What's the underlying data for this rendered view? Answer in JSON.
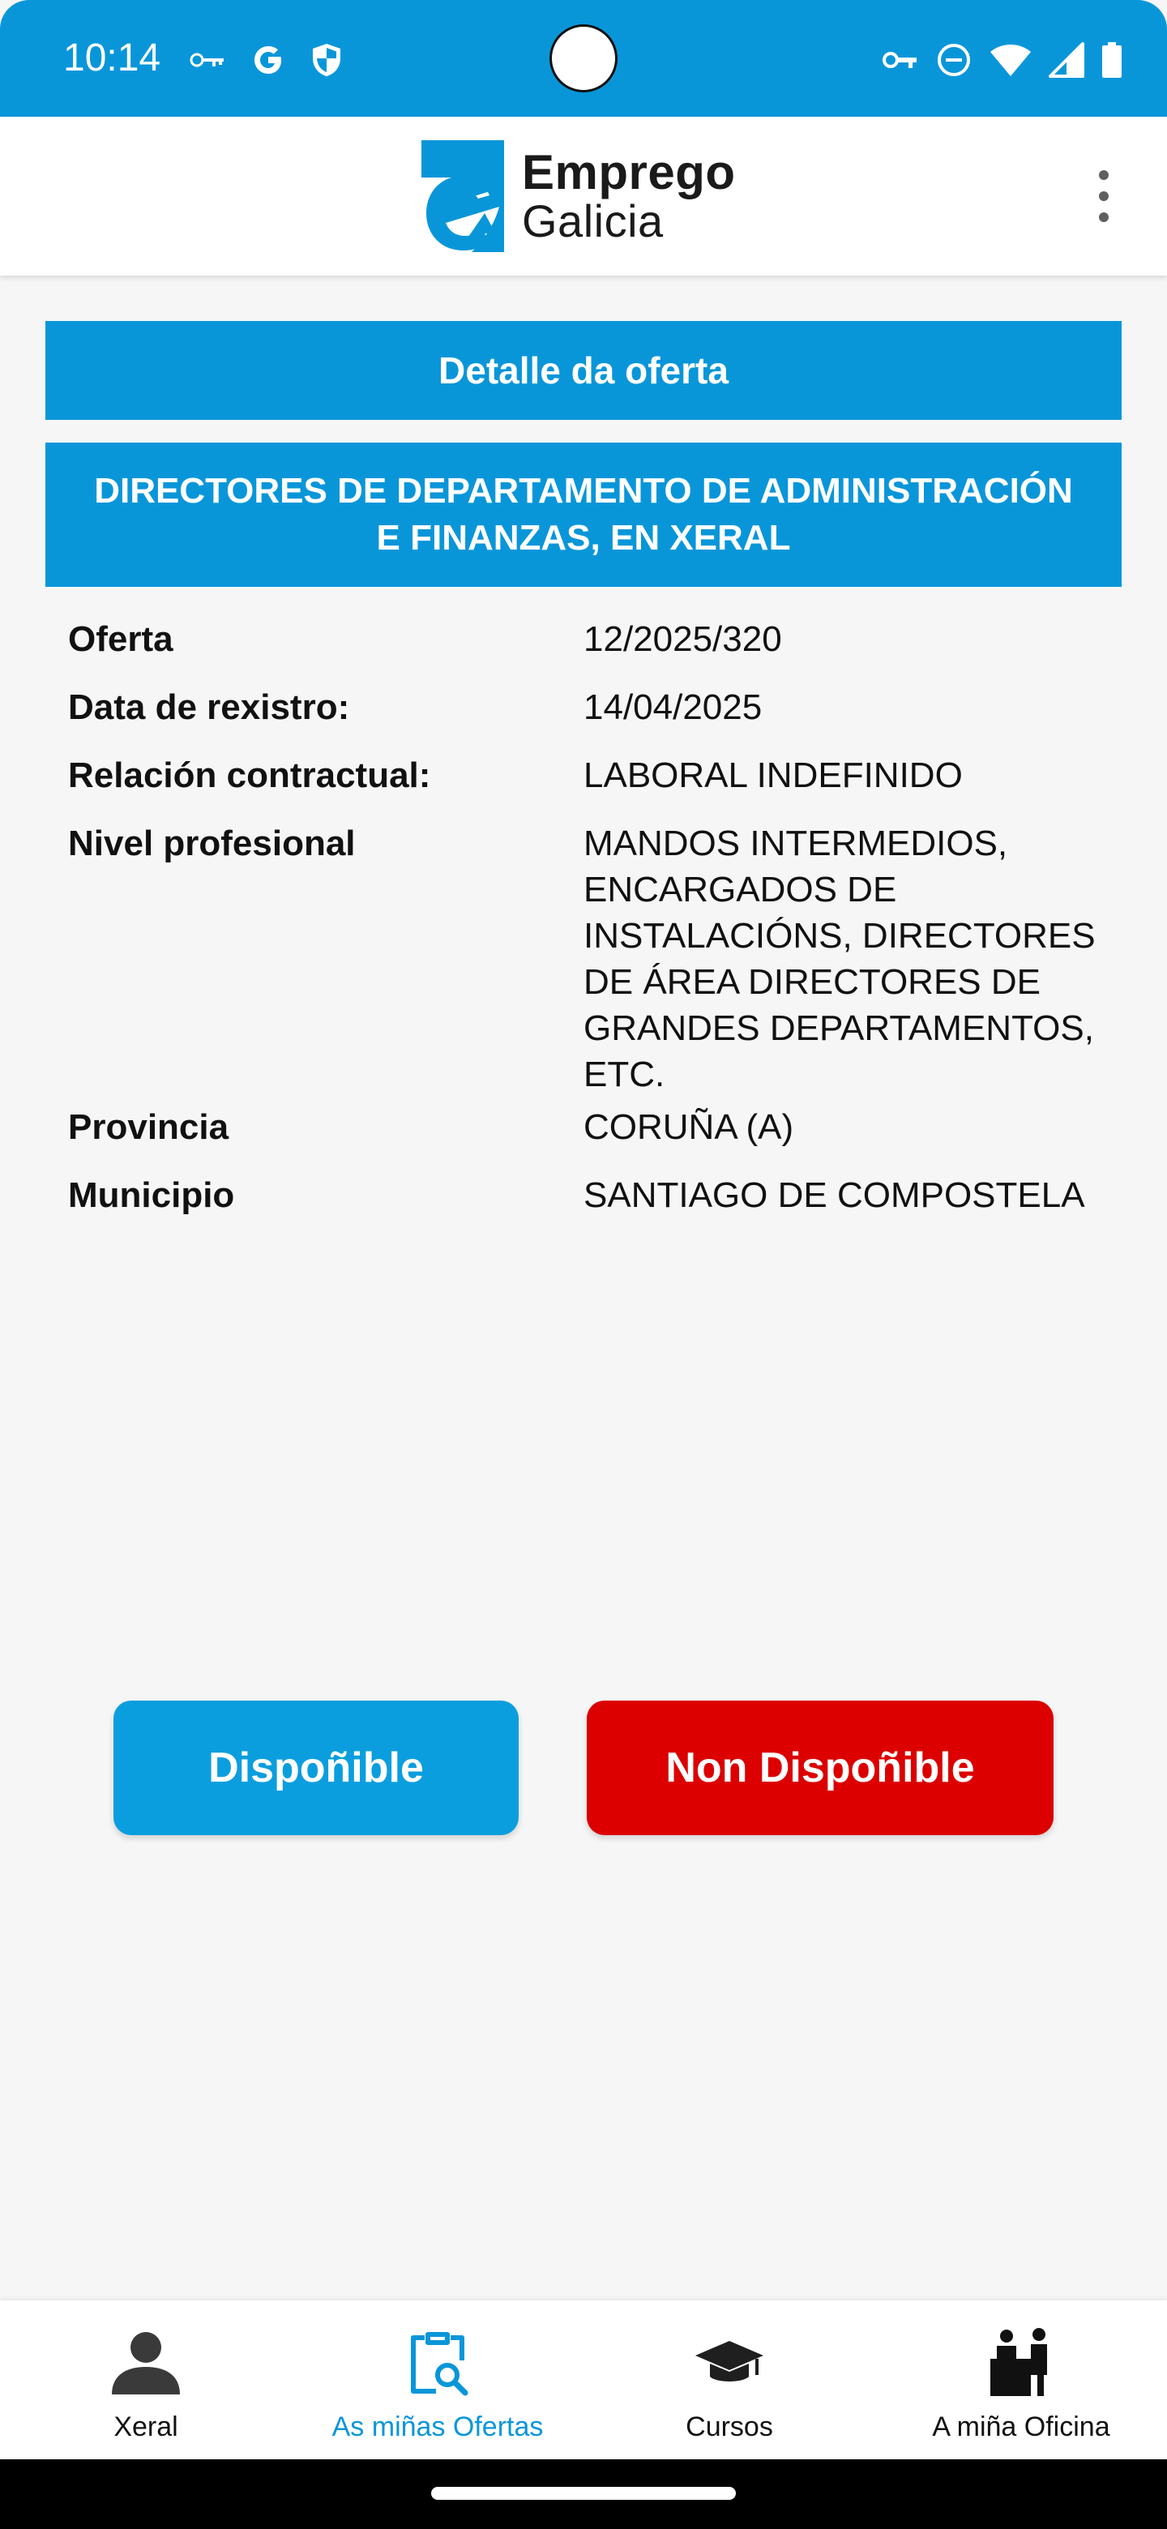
{
  "status_bar": {
    "time": "10:14",
    "left_icons": [
      "key-icon",
      "google-icon",
      "shield-icon"
    ],
    "right_icons": [
      "vpn-key-icon",
      "do-not-disturb-icon",
      "wifi-icon",
      "cellular-signal-icon",
      "battery-icon"
    ]
  },
  "header": {
    "logo_line1": "Emprego",
    "logo_line2": "Galicia",
    "menu_icon": "more-vertical-icon"
  },
  "detail": {
    "title": "Detalle da oferta",
    "offer_title": "DIRECTORES DE DEPARTAMENTO DE ADMINISTRACIÓN E FINANZAS, EN XERAL",
    "fields": [
      {
        "label": "Oferta",
        "value": "12/2025/320"
      },
      {
        "label": "Data de rexistro:",
        "value": "14/04/2025"
      },
      {
        "label": "Relación contractual:",
        "value": "LABORAL INDEFINIDO"
      },
      {
        "label": "Nivel profesional",
        "value": "MANDOS INTERMEDIOS, ENCARGADOS DE INSTALACIÓNS, DIRECTORES DE ÁREA DIRECTORES DE GRANDES DEPARTAMENTOS, ETC."
      },
      {
        "label": "Provincia",
        "value": "CORUÑA (A)"
      },
      {
        "label": "Municipio",
        "value": "SANTIAGO DE COMPOSTELA"
      }
    ]
  },
  "actions": {
    "available_label": "Dispoñible",
    "unavailable_label": "Non Dispoñible"
  },
  "bottom_nav": {
    "items": [
      {
        "label": "Xeral",
        "icon": "person-icon",
        "active": false
      },
      {
        "label": "As miñas Ofertas",
        "icon": "clipboard-search-icon",
        "active": true
      },
      {
        "label": "Cursos",
        "icon": "graduation-cap-icon",
        "active": false
      },
      {
        "label": "A miña Oficina",
        "icon": "office-desk-icon",
        "active": false
      }
    ]
  },
  "colors": {
    "primary": "#0996d9",
    "danger": "#dc0000",
    "background": "#f6f6f6"
  }
}
